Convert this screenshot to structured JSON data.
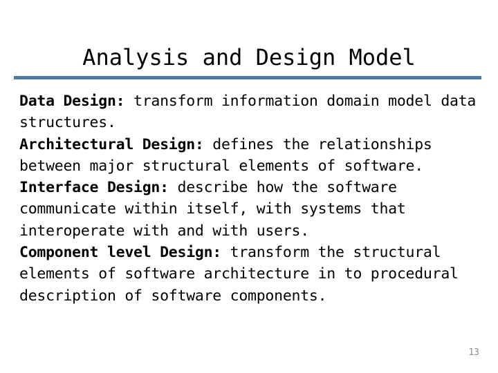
{
  "slide": {
    "title": "Analysis and Design Model",
    "accent_color": "#4f7ba7",
    "background_color": "#ffffff",
    "text_color": "#000000",
    "slide_number_color": "#8c8c8c",
    "slide_number": "13",
    "paragraphs": [
      {
        "lead": "Data Design:",
        "rest": " transform information domain model data structures."
      },
      {
        "lead": "Architectural Design:",
        "rest": " defines the relationships between major structural elements of software."
      },
      {
        "lead": "Interface Design:",
        "rest": " describe how the software communicate within itself, with systems that interoperate with and with users."
      },
      {
        "lead": "Component level Design:",
        "rest": " transform the structural elements of software architecture in to procedural description of software components."
      }
    ]
  }
}
